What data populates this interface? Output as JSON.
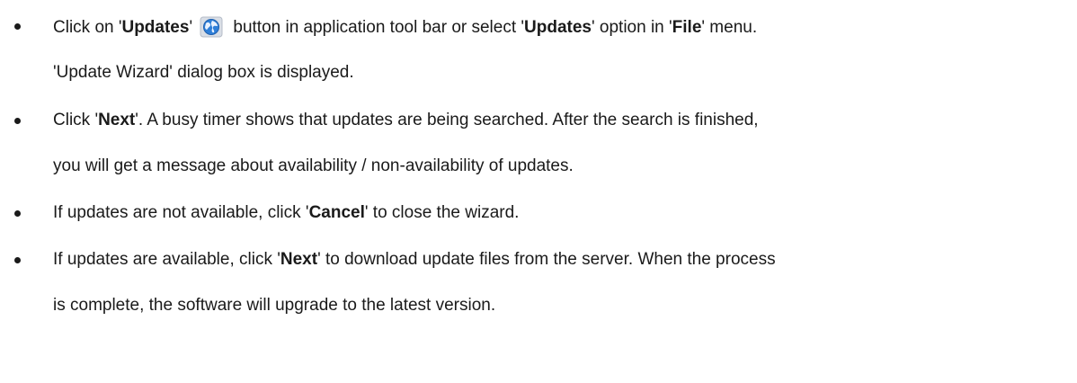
{
  "steps": [
    {
      "line1": {
        "t1": "Click on '",
        "b1": "Updates",
        "t2": "'",
        "t3": " button in application tool bar or select '",
        "b2": "Updates",
        "t4": "' option in '",
        "b3": "File",
        "t5": "' menu."
      },
      "line2": "'Update Wizard' dialog box is displayed.",
      "icon": "globe-update-icon"
    },
    {
      "line1": {
        "t1": "Click '",
        "b1": "Next",
        "t2": "'. A busy timer shows that updates are being searched. After the search is finished,"
      },
      "line2": "you will get a message about availability / non-availability of updates."
    },
    {
      "line1": {
        "t1": "If updates are not available, click '",
        "b1": "Cancel",
        "t2": "' to close the wizard."
      }
    },
    {
      "line1": {
        "t1": "If updates are available, click '",
        "b1": "Next",
        "t2": "' to download update files from the server. When the process"
      },
      "line2": "is complete, the software will upgrade to the latest version."
    }
  ],
  "colors": {
    "text": "#1a1a1a",
    "icon_blue": "#2f7fd8",
    "icon_frame": "#d9dee6"
  }
}
